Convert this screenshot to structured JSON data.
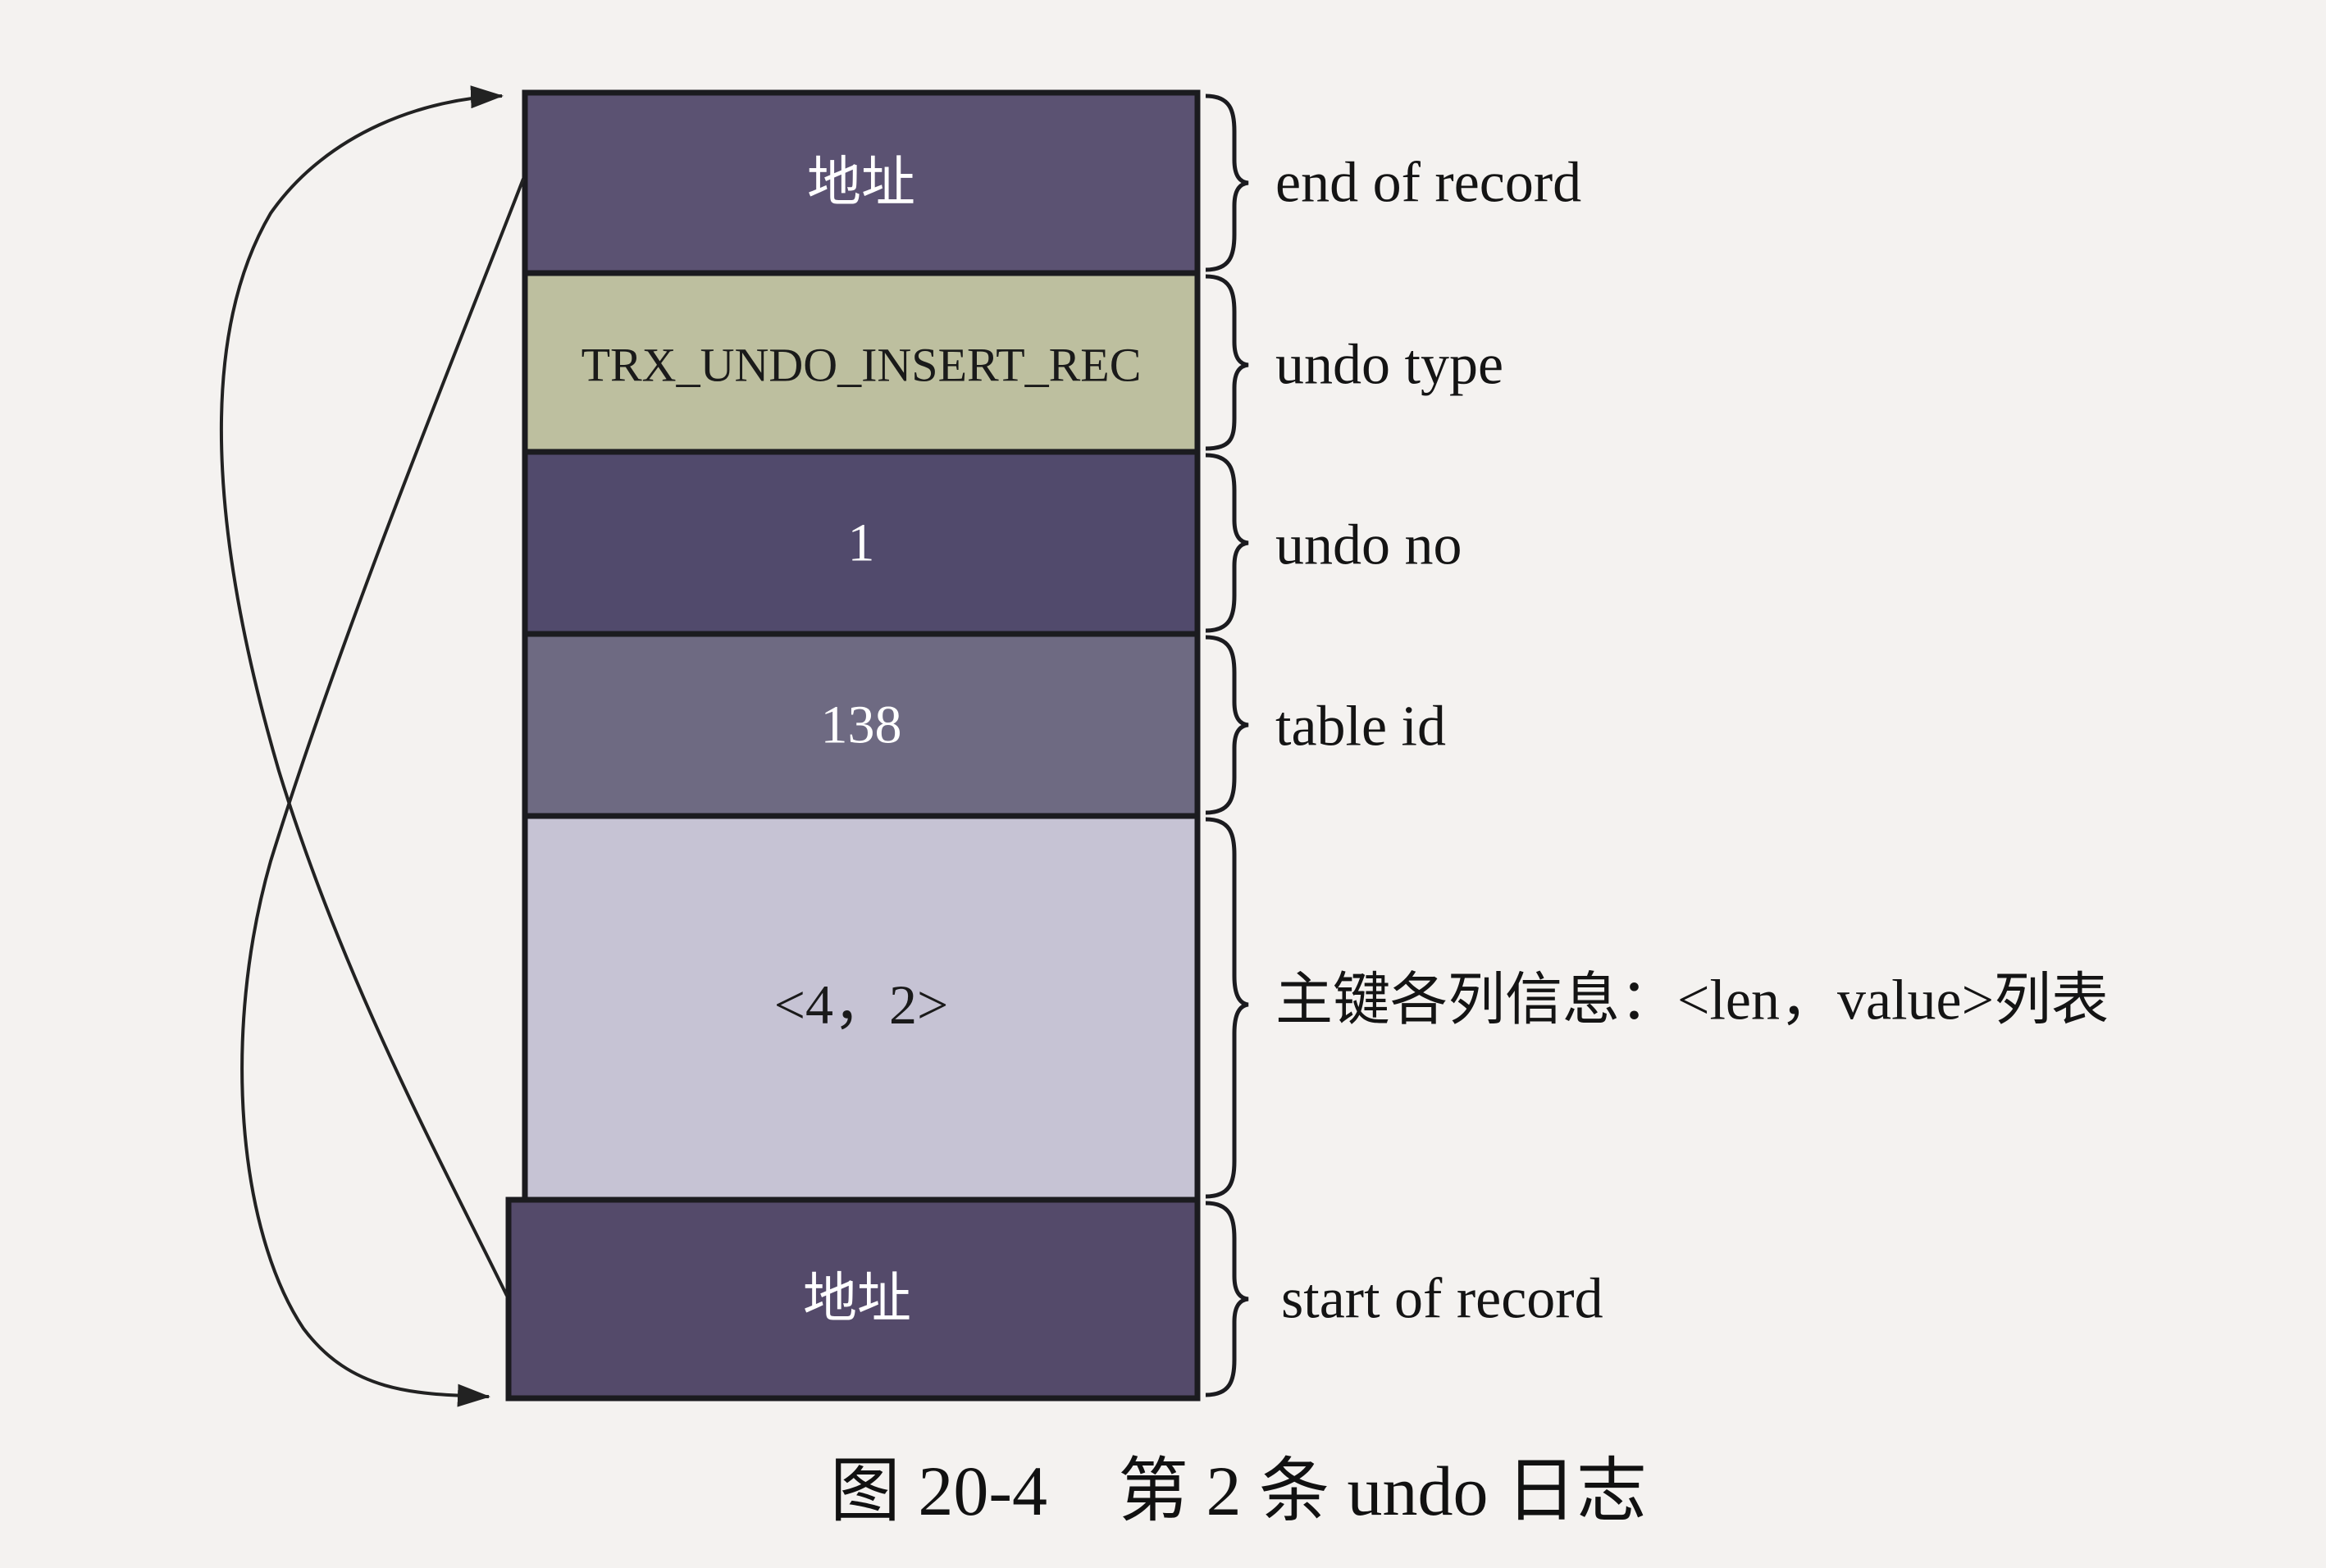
{
  "diagram": {
    "cells": [
      {
        "text": "地址",
        "label": "end of record",
        "fill": "#5b5272"
      },
      {
        "text": "TRX_UNDO_INSERT_REC",
        "label": "undo type",
        "fill": "#bdbf9f"
      },
      {
        "text": "1",
        "label": "undo no",
        "fill": "#514a6c"
      },
      {
        "text": "138",
        "label": "table id",
        "fill": "#6e6a82"
      },
      {
        "text": "<4，2>",
        "label": "主键各列信息：<len，value>列表",
        "fill": "#c6c3d4"
      },
      {
        "text": "地址",
        "label": "start of record",
        "fill": "#544a6a"
      }
    ]
  },
  "caption": "图 20-4　第 2 条 undo 日志"
}
